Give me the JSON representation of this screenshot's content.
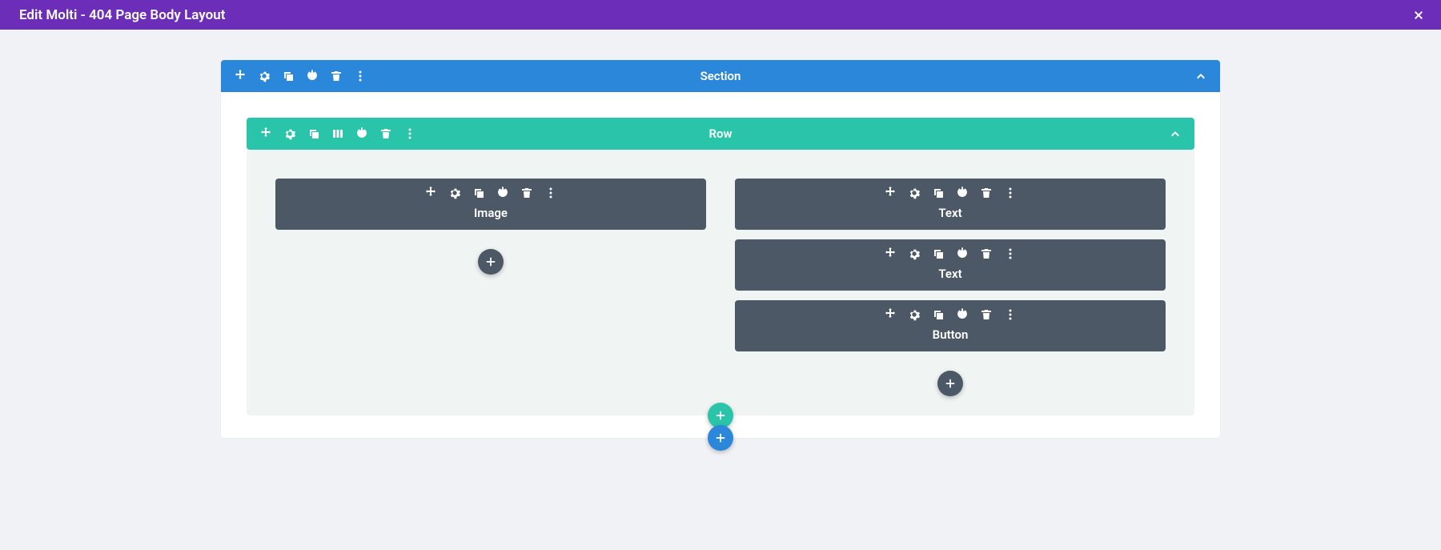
{
  "titlebar": {
    "title": "Edit Molti - 404 Page Body Layout"
  },
  "section": {
    "label": "Section",
    "row": {
      "label": "Row",
      "columns": [
        {
          "modules": [
            "Image"
          ]
        },
        {
          "modules": [
            "Text",
            "Text",
            "Button"
          ]
        }
      ]
    }
  }
}
